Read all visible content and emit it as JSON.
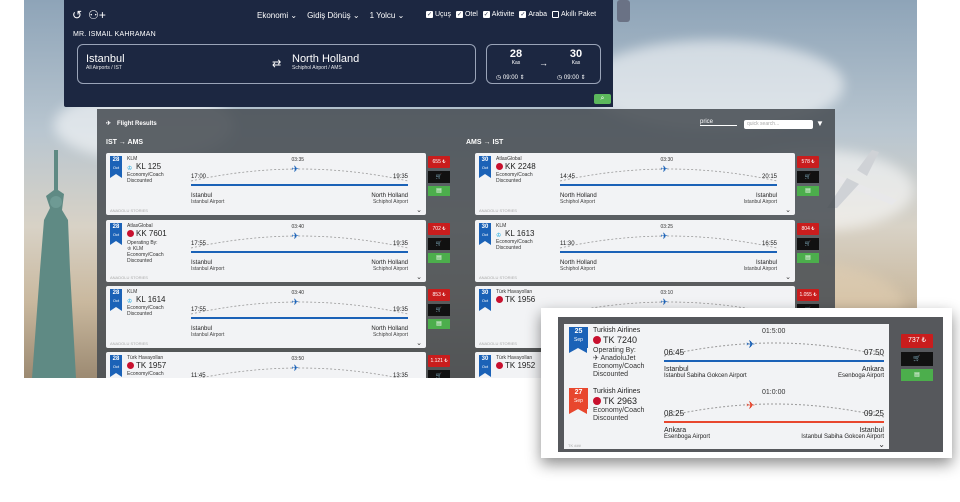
{
  "search": {
    "cabin": "Ekonomi",
    "trip_type": "Gidiş Dönüş",
    "passengers": "1 Yolcu",
    "products": [
      "Uçuş",
      "Otel",
      "Aktivite",
      "Araba",
      "Akıllı Paket"
    ],
    "user": "MR. ISMAIL KAHRAMAN",
    "origin": {
      "city": "Istanbul",
      "sub": "All Airports / IST"
    },
    "destination": {
      "city": "North Holland",
      "sub": "Schiphol Airport / AMS"
    },
    "dep_date": {
      "day": "28",
      "month": "Kas",
      "time": "09:00"
    },
    "ret_date": {
      "day": "30",
      "month": "Kas",
      "time": "09:00"
    }
  },
  "results": {
    "title": "Flight Results",
    "sort": "price",
    "quick_search_placeholder": "quick search...",
    "outbound_label": "IST → AMS",
    "return_label": "AMS → IST",
    "footer_note": "ANADOLU STORIES",
    "outbound": [
      {
        "day": "28",
        "mon": "Oct",
        "airline": "KLM",
        "flight": "KL 125",
        "icon": "klm",
        "operating": "",
        "cabin": "Economy/Coach",
        "fare": "Discounted",
        "duration": "03:35",
        "dep": "17:00",
        "arr": "19:35",
        "dep_city": "Istanbul",
        "dep_ap": "Istanbul Airport",
        "arr_city": "North Holland",
        "arr_ap": "Schiphol Airport",
        "price": "655 ₺"
      },
      {
        "day": "28",
        "mon": "Oct",
        "airline": "AtlasGlobal",
        "flight": "KK 7601",
        "icon": "atlas",
        "operating": "Operating By:",
        "operating_by": "KLM",
        "cabin": "Economy/Coach",
        "fare": "Discounted",
        "duration": "03:40",
        "dep": "17:55",
        "arr": "19:35",
        "dep_city": "Istanbul",
        "dep_ap": "Istanbul Airport",
        "arr_city": "North Holland",
        "arr_ap": "Schiphol Airport",
        "price": "702 ₺"
      },
      {
        "day": "28",
        "mon": "Oct",
        "airline": "KLM",
        "flight": "KL 1614",
        "icon": "klm",
        "operating": "",
        "cabin": "Economy/Coach",
        "fare": "Discounted",
        "duration": "03:40",
        "dep": "17:55",
        "arr": "19:35",
        "dep_city": "Istanbul",
        "dep_ap": "Istanbul Airport",
        "arr_city": "North Holland",
        "arr_ap": "Schiphol Airport",
        "price": "853 ₺"
      },
      {
        "day": "28",
        "mon": "Oct",
        "airline": "Türk Havayolları",
        "flight": "TK 1957",
        "icon": "tk",
        "operating": "",
        "cabin": "Economy/Coach",
        "fare": "",
        "duration": "03:50",
        "dep": "11:45",
        "arr": "13:35",
        "dep_city": "",
        "dep_ap": "",
        "arr_city": "",
        "arr_ap": "",
        "price": "1.121 ₺"
      }
    ],
    "return": [
      {
        "day": "30",
        "mon": "Oct",
        "airline": "AtlasGlobal",
        "flight": "KK 2248",
        "icon": "atlas",
        "operating": "",
        "cabin": "Economy/Coach",
        "fare": "Discounted",
        "duration": "03:30",
        "dep": "14:45",
        "arr": "20:15",
        "dep_city": "North Holland",
        "dep_ap": "Schiphol Airport",
        "arr_city": "Istanbul",
        "arr_ap": "Istanbul Airport",
        "price": "578 ₺"
      },
      {
        "day": "30",
        "mon": "Oct",
        "airline": "KLM",
        "flight": "KL 1613",
        "icon": "klm",
        "operating": "",
        "cabin": "Economy/Coach",
        "fare": "Discounted",
        "duration": "03:25",
        "dep": "11:30",
        "arr": "16:55",
        "dep_city": "North Holland",
        "dep_ap": "Schiphol Airport",
        "arr_city": "Istanbul",
        "arr_ap": "Istanbul Airport",
        "price": "804 ₺"
      },
      {
        "day": "30",
        "mon": "Oct",
        "airline": "Türk Havayolları",
        "flight": "TK 1956",
        "icon": "tk",
        "operating": "",
        "cabin": "",
        "fare": "",
        "duration": "03:10",
        "dep": "",
        "arr": "",
        "dep_city": "",
        "dep_ap": "",
        "arr_city": "",
        "arr_ap": "",
        "price": "1.055 ₺"
      },
      {
        "day": "30",
        "mon": "Oct",
        "airline": "Türk Havayolları",
        "flight": "TK 1952",
        "icon": "tk",
        "operating": "",
        "cabin": "",
        "fare": "",
        "duration": "",
        "dep": "",
        "arr": "",
        "dep_city": "",
        "dep_ap": "",
        "arr_city": "",
        "arr_ap": "",
        "price": ""
      }
    ]
  },
  "zoom": {
    "price": "737 ₺",
    "footer": "TK ###",
    "legs": [
      {
        "day": "25",
        "mon": "Sep",
        "color": "#1b62b7",
        "airline": "Turkish Airlines",
        "flight": "TK 7240",
        "operating": "Operating By:",
        "operating_by": "AnadoluJet",
        "cabin": "Economy/Coach",
        "fare": "Discounted",
        "duration": "01:5:00",
        "dep": "06:45",
        "arr": "07:50",
        "dep_city": "Istanbul",
        "dep_ap": "Istanbul Sabiha Gokcen Airport",
        "arr_city": "Ankara",
        "arr_ap": "Esenboga Airport"
      },
      {
        "day": "27",
        "mon": "Sep",
        "color": "#e8472e",
        "airline": "Turkish Airlines",
        "flight": "TK 2963",
        "operating": "",
        "cabin": "Economy/Coach",
        "fare": "Discounted",
        "duration": "01:0:00",
        "dep": "08:25",
        "arr": "09:25",
        "dep_city": "Ankara",
        "dep_ap": "Esenboga Airport",
        "arr_city": "Istanbul",
        "arr_ap": "Istanbul Sabiha Gokcen Airport"
      }
    ]
  },
  "colors": {
    "navy": "#1c2741",
    "blue": "#1b62b7",
    "red": "#c91d1d",
    "green": "#4cae4c",
    "orange": "#e8472e"
  }
}
